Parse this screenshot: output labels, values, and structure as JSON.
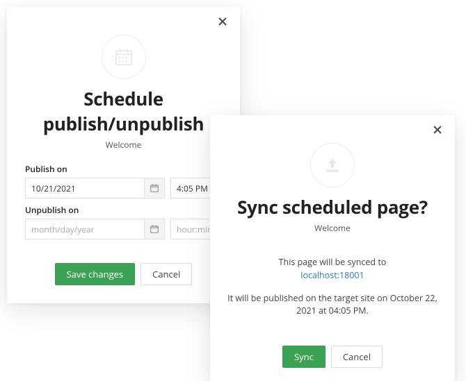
{
  "schedule": {
    "title": "Schedule publish/unpublish",
    "subtitle": "Welcome",
    "publish_label": "Publish on",
    "unpublish_label": "Unpublish on",
    "publish_date_value": "10/21/2021",
    "publish_time_value": "4:05 PM",
    "date_placeholder": "month/day/year",
    "time_placeholder": "hour:minute AM",
    "save_label": "Save changes",
    "cancel_label": "Cancel"
  },
  "sync": {
    "title": "Sync scheduled page?",
    "subtitle": "Welcome",
    "line1": "This page will be synced to",
    "target_link": "localhost:18001",
    "line2": "It will be published on the target site on October 22, 2021 at 04:05 PM.",
    "sync_label": "Sync",
    "cancel_label": "Cancel"
  }
}
